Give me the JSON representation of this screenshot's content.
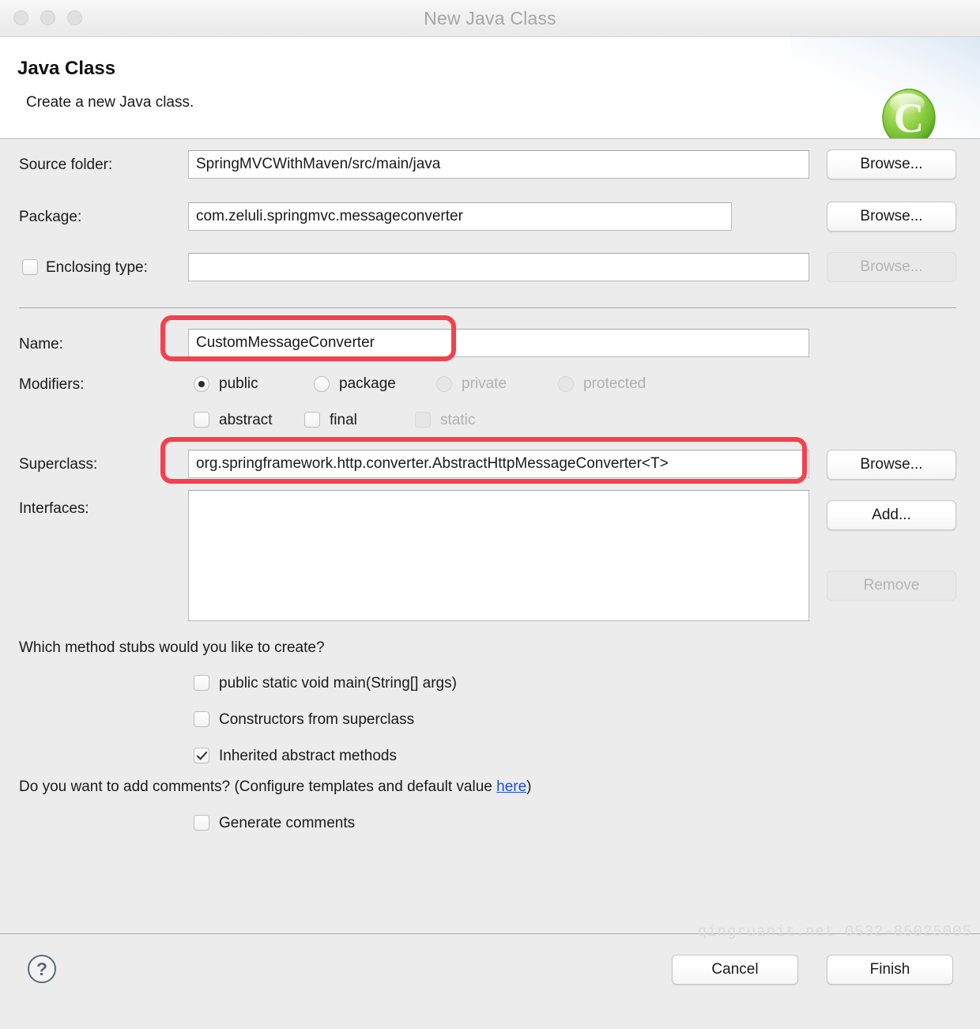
{
  "window": {
    "title": "New Java Class",
    "traffic_lights": [
      "close-button",
      "minimize-button",
      "zoom-button"
    ]
  },
  "header": {
    "title": "Java Class",
    "subtitle": "Create a new Java class.",
    "icon": "java-class-icon"
  },
  "form": {
    "source_folder": {
      "label": "Source folder:",
      "value": "SpringMVCWithMaven/src/main/java",
      "button": "Browse..."
    },
    "package": {
      "label": "Package:",
      "value": "com.zeluli.springmvc.messageconverter",
      "button": "Browse..."
    },
    "enclosing_type": {
      "label": "Enclosing type:",
      "value": "",
      "checked": false,
      "button": "Browse...",
      "button_disabled": true
    },
    "name": {
      "label": "Name:",
      "value": "CustomMessageConverter",
      "annotated": true
    },
    "modifiers": {
      "label": "Modifiers:",
      "radios": [
        {
          "label": "public",
          "checked": true,
          "disabled": false
        },
        {
          "label": "package",
          "checked": false,
          "disabled": false
        },
        {
          "label": "private",
          "checked": false,
          "disabled": true
        },
        {
          "label": "protected",
          "checked": false,
          "disabled": true
        }
      ],
      "checkboxes": [
        {
          "label": "abstract",
          "checked": false,
          "disabled": false
        },
        {
          "label": "final",
          "checked": false,
          "disabled": false
        },
        {
          "label": "static",
          "checked": false,
          "disabled": true
        }
      ]
    },
    "superclass": {
      "label": "Superclass:",
      "value": "org.springframework.http.converter.AbstractHttpMessageConverter<T>",
      "button": "Browse...",
      "annotated": true
    },
    "interfaces": {
      "label": "Interfaces:",
      "items": [],
      "add_button": "Add...",
      "remove_button": "Remove",
      "remove_disabled": true
    }
  },
  "stubs": {
    "question": "Which method stubs would you like to create?",
    "options": [
      {
        "label": "public static void main(String[] args)",
        "checked": false
      },
      {
        "label": "Constructors from superclass",
        "checked": false
      },
      {
        "label": "Inherited abstract methods",
        "checked": true
      }
    ]
  },
  "comments": {
    "question_prefix": "Do you want to add comments? (Configure templates and default value ",
    "link": "here",
    "question_suffix": ")",
    "option": {
      "label": "Generate comments",
      "checked": false
    }
  },
  "footer": {
    "help": "help-button",
    "cancel": "Cancel",
    "finish": "Finish",
    "watermark": "qingruanit.net  0532-85025005"
  },
  "colors": {
    "annotation": "#f5404d",
    "link": "#1a4fd6",
    "dialog_bg": "#ececec",
    "icon_green": "#7cc63f"
  }
}
